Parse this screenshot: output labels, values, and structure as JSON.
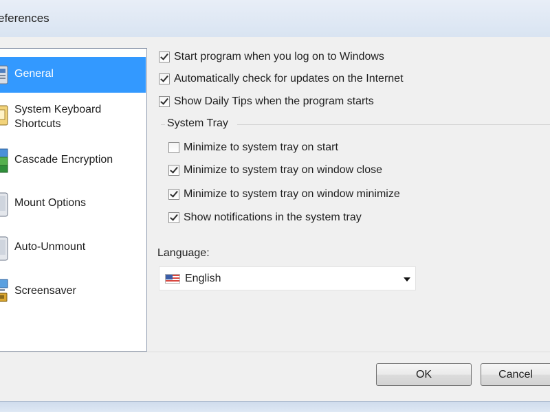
{
  "window": {
    "title": "eferences"
  },
  "sidebar": {
    "items": [
      {
        "label": "General",
        "icon": "general-icon",
        "selected": true
      },
      {
        "label": "System Keyboard\nShortcuts",
        "icon": "keyboard-icon",
        "selected": false
      },
      {
        "label": "Cascade Encryption",
        "icon": "encryption-icon",
        "selected": false
      },
      {
        "label": "Mount Options",
        "icon": "mount-icon",
        "selected": false
      },
      {
        "label": "Auto-Unmount",
        "icon": "unmount-icon",
        "selected": false
      },
      {
        "label": "Screensaver",
        "icon": "screensaver-icon",
        "selected": false
      }
    ]
  },
  "general": {
    "options": [
      {
        "label": "Start program when you log on to Windows",
        "checked": true
      },
      {
        "label": "Automatically check for updates on the Internet",
        "checked": true
      },
      {
        "label": "Show Daily Tips when the program starts",
        "checked": true
      }
    ],
    "system_tray": {
      "title": "System Tray",
      "options": [
        {
          "label": "Minimize to system tray on start",
          "checked": false
        },
        {
          "label": "Minimize to system tray on window close",
          "checked": true
        },
        {
          "label": "Minimize to system tray on window minimize",
          "checked": true
        },
        {
          "label": "Show notifications in the system tray",
          "checked": true
        }
      ]
    },
    "language": {
      "label": "Language:",
      "value": "English",
      "flag": "us-flag-icon"
    }
  },
  "buttons": {
    "ok": "OK",
    "cancel": "Cancel"
  },
  "colors": {
    "selection": "#3399ff",
    "window_bg": "#f0f0f0"
  }
}
